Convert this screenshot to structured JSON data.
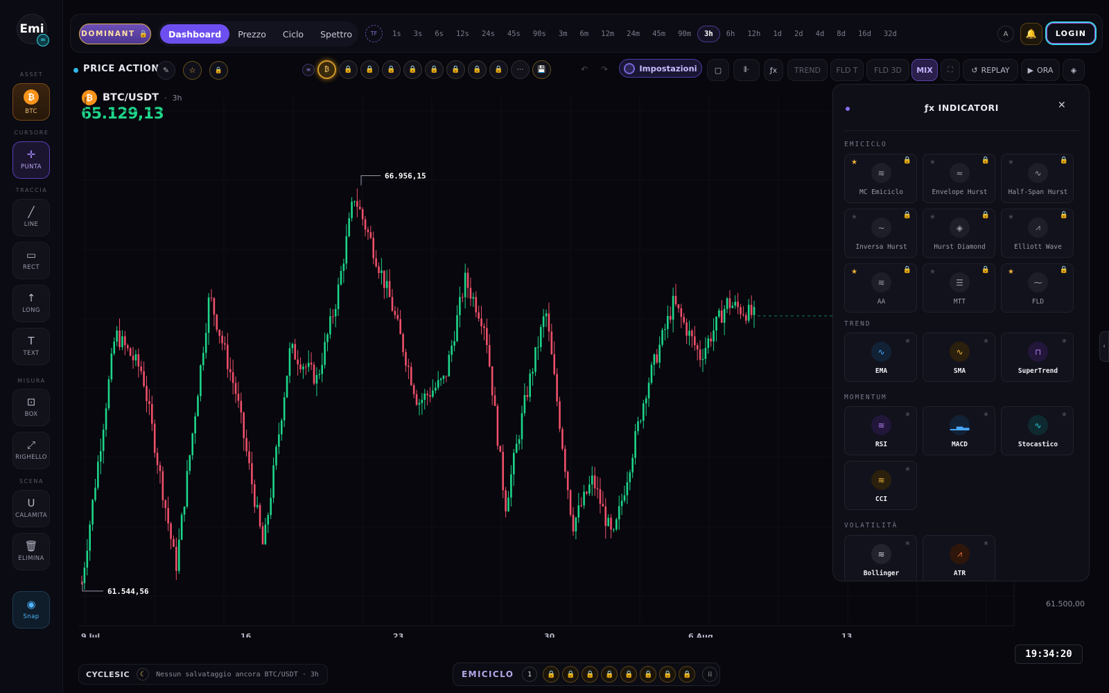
{
  "app": {
    "logo_text": "Emi",
    "logo_badge": "∞"
  },
  "rail": {
    "sections": {
      "asset": "ASSET",
      "cursore": "CURSORE",
      "traccia": "TRACCIA",
      "misura": "MISURA",
      "scena": "SCENA"
    },
    "asset_btc": "BTC",
    "tools": {
      "punta": "PUNTA",
      "line": "LINE",
      "rect": "RECT",
      "long": "LONG",
      "text": "TEXT",
      "box": "BOX",
      "righello": "RIGHELLO",
      "calamita": "CALAMITA",
      "elimina": "ELIMINA",
      "snap": "Snap"
    },
    "icons": {
      "btc": "₿",
      "punta": "✛",
      "line": "╱",
      "rect": "▭",
      "long": "↑",
      "text": "T",
      "box": "⊡",
      "righello": "⤢",
      "calamita": "U",
      "elimina": "🗑",
      "snap": "◉"
    }
  },
  "topbar": {
    "dominant": "DOMINANT",
    "tabs": [
      "Dashboard",
      "Prezzo",
      "Ciclo",
      "Spettro"
    ],
    "active_tab": 0,
    "tf_icon": "TF",
    "timeframes": [
      "1s",
      "3s",
      "6s",
      "12s",
      "24s",
      "45s",
      "90s",
      "3m",
      "6m",
      "12m",
      "24m",
      "45m",
      "90m",
      "3h",
      "6h",
      "12h",
      "1d",
      "2d",
      "4d",
      "8d",
      "16d",
      "32d"
    ],
    "active_timeframe": "3h",
    "a_btn": "A",
    "login": "LOGIN"
  },
  "toolbar2": {
    "price_action": "PRICE ACTION",
    "impostazioni": "Impostazioni",
    "trend": "TREND",
    "fld_t": "FLD T",
    "fld_3d": "FLD 3D",
    "mix": "MIX",
    "replay": "REPLAY",
    "ora": "ORA",
    "fx": "ƒx"
  },
  "chart": {
    "symbol": "BTC/USDT",
    "timeframe": "3h",
    "price": "65.129,13",
    "high_label": "66.956,15",
    "low_label": "61.544,56",
    "y_label": "61.500,00",
    "x_labels": [
      "9 Jul",
      "16",
      "23",
      "30",
      "6 Aug",
      "13"
    ],
    "clock": "19:34:20"
  },
  "chart_data": {
    "type": "candlestick",
    "symbol": "BTC/USDT",
    "x_ticks": [
      "9 Jul",
      "16",
      "23",
      "30",
      "6 Aug",
      "13"
    ],
    "annotated_high": 66956.15,
    "annotated_low": 61544.56,
    "last_price": 65129.13,
    "y_tick": 61500.0,
    "ylim": [
      61300,
      67800
    ],
    "anchors": [
      {
        "t": 0,
        "v": 61650
      },
      {
        "t": 0.05,
        "v": 64900
      },
      {
        "t": 0.09,
        "v": 64400
      },
      {
        "t": 0.14,
        "v": 61850
      },
      {
        "t": 0.19,
        "v": 65400
      },
      {
        "t": 0.23,
        "v": 64100
      },
      {
        "t": 0.27,
        "v": 62100
      },
      {
        "t": 0.31,
        "v": 64700
      },
      {
        "t": 0.35,
        "v": 64300
      },
      {
        "t": 0.38,
        "v": 65400
      },
      {
        "t": 0.405,
        "v": 66700
      },
      {
        "t": 0.43,
        "v": 66100
      },
      {
        "t": 0.46,
        "v": 65300
      },
      {
        "t": 0.5,
        "v": 64000
      },
      {
        "t": 0.54,
        "v": 64300
      },
      {
        "t": 0.57,
        "v": 65600
      },
      {
        "t": 0.6,
        "v": 65000
      },
      {
        "t": 0.63,
        "v": 62650
      },
      {
        "t": 0.66,
        "v": 64050
      },
      {
        "t": 0.69,
        "v": 65200
      },
      {
        "t": 0.73,
        "v": 62400
      },
      {
        "t": 0.76,
        "v": 63000
      },
      {
        "t": 0.79,
        "v": 62200
      },
      {
        "t": 0.84,
        "v": 64200
      },
      {
        "t": 0.88,
        "v": 65300
      },
      {
        "t": 0.92,
        "v": 64600
      },
      {
        "t": 0.96,
        "v": 65300
      },
      {
        "t": 1,
        "v": 65129
      }
    ]
  },
  "bottom": {
    "cyclesic": "CYCLESIC",
    "status": "Nessun salvataggio ancora  BTC/USDT · 3h",
    "emiciclo": "EMICICLO",
    "emiciclo_num": "1"
  },
  "panel": {
    "title": "ƒx INDICATORI",
    "close": "✕",
    "sections": {
      "emiciclo": "EMICICLO",
      "trend": "TREND",
      "momentum": "MOMENTUM",
      "volatilita": "VOLATILITÀ"
    },
    "emiciclo_cards": [
      {
        "name": "MC Emiciclo",
        "icon": "≋",
        "starred": true
      },
      {
        "name": "Envelope Hurst",
        "icon": "≈",
        "starred": false
      },
      {
        "name": "Half-Span Hurst",
        "icon": "∿",
        "starred": false
      },
      {
        "name": "Inversa Hurst",
        "icon": "∼",
        "starred": false
      },
      {
        "name": "Hurst Diamond",
        "icon": "◈",
        "starred": false
      },
      {
        "name": "Elliott Wave",
        "icon": "⩘",
        "starred": false
      },
      {
        "name": "AA",
        "icon": "≋",
        "starred": true
      },
      {
        "name": "MTT",
        "icon": "☰",
        "starred": false
      },
      {
        "name": "FLD",
        "icon": "⁓",
        "starred": true
      }
    ],
    "trend_cards": [
      {
        "name": "EMA",
        "icon": "∿",
        "color": "#4aa8ff",
        "bg": "#112236"
      },
      {
        "name": "SMA",
        "icon": "∿",
        "color": "#f0b43a",
        "bg": "#2b200d"
      },
      {
        "name": "SuperTrend",
        "icon": "⊓",
        "color": "#b07cf0",
        "bg": "#22163a"
      }
    ],
    "momentum_cards": [
      {
        "name": "RSI",
        "icon": "≋",
        "color": "#b07cf0",
        "bg": "#22163a"
      },
      {
        "name": "MACD",
        "icon": "▁▃▂",
        "color": "#4aa8ff",
        "bg": "#112236"
      },
      {
        "name": "Stocastico",
        "icon": "∿",
        "color": "#2dd4e6",
        "bg": "#0e2a30"
      },
      {
        "name": "CCI",
        "icon": "≋",
        "color": "#f0b43a",
        "bg": "#2b200d"
      }
    ],
    "volatilita_cards": [
      {
        "name": "Bollinger",
        "icon": "≋",
        "color": "#c9c9d6",
        "bg": "#23232e"
      },
      {
        "name": "ATR",
        "icon": "⩘",
        "color": "#ff7a3a",
        "bg": "#2e160b"
      }
    ]
  },
  "colors": {
    "bull": "#1ed68a",
    "bear": "#f0506a",
    "accent": "#6d4ff0",
    "gold": "#f0b43a"
  }
}
